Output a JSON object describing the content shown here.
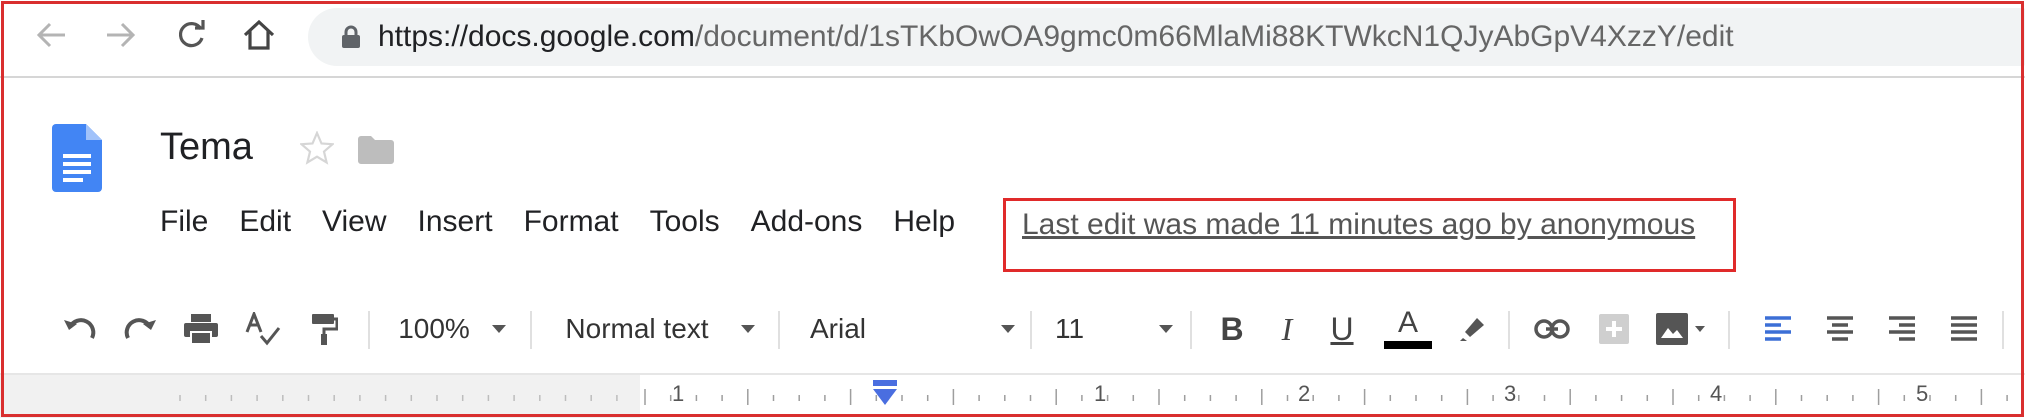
{
  "browser": {
    "url_host": "https://docs.google.com",
    "url_path": "/document/d/1sTKbOwOA9gmc0m66MlaMi88KTWkcN1QJyAbGpV4XzzY/edit",
    "icons": [
      "back-arrow-icon",
      "forward-arrow-icon",
      "reload-icon",
      "home-icon",
      "lock-icon"
    ]
  },
  "document": {
    "title": "Tema"
  },
  "menu": {
    "items": [
      "File",
      "Edit",
      "View",
      "Insert",
      "Format",
      "Tools",
      "Add-ons",
      "Help"
    ],
    "last_edit": "Last edit was made 11 minutes ago by anonymous"
  },
  "toolbar": {
    "zoom": "100%",
    "style": "Normal text",
    "font": "Arial",
    "font_size": "11",
    "bold_label": "B",
    "italic_label": "I",
    "underline_label": "U",
    "text_color_label": "A"
  },
  "ruler": {
    "labels": [
      "1",
      "1",
      "2",
      "3",
      "4",
      "5"
    ]
  },
  "colors": {
    "highlight_border": "#e02a2a",
    "docs_blue": "#4285f4",
    "text_color_swatch": "#000000",
    "indent_marker": "#4a6ee0"
  }
}
